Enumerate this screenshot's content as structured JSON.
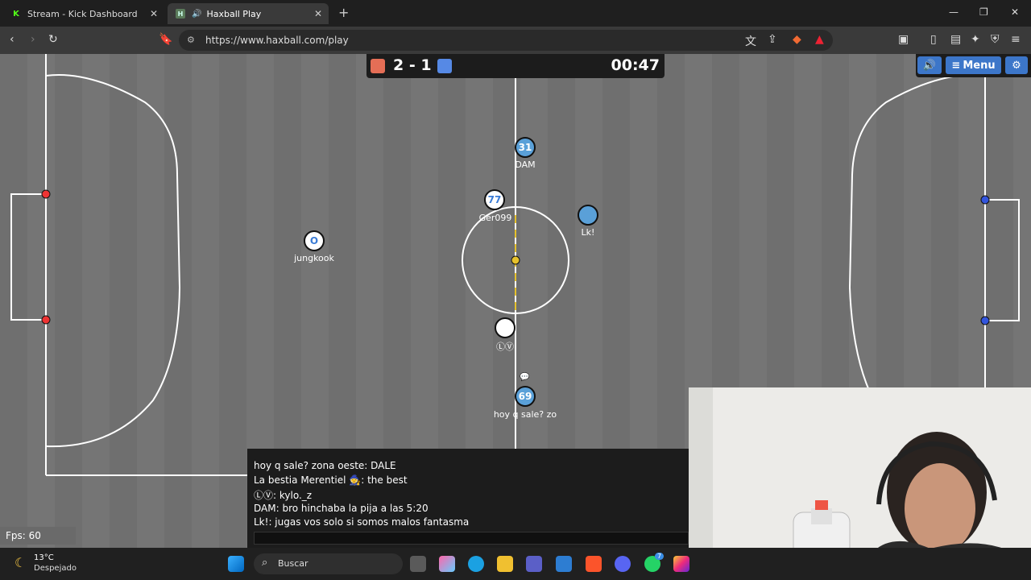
{
  "browser": {
    "tabs": [
      {
        "title": "Stream - Kick Dashboard",
        "favicon": "K"
      },
      {
        "title": "Haxball Play",
        "favicon": "H",
        "active": true,
        "audio": true
      }
    ],
    "new_tab": "+",
    "url": "https://www.haxball.com/play",
    "window": {
      "minimize": "—",
      "maximize": "❐",
      "close": "✕"
    }
  },
  "scoreboard": {
    "red_color": "#e56e56",
    "blue_color": "#5689e5",
    "score": "2 - 1",
    "timer": "00:47"
  },
  "topbar": {
    "sound_icon": "speaker-icon",
    "menu_label": "Menu",
    "settings_icon": "gear-icon"
  },
  "players": [
    {
      "label": "31",
      "name": "DAM",
      "team": "blue"
    },
    {
      "label": "77",
      "name": "Ger099",
      "team": "white"
    },
    {
      "label": "",
      "name": "Lk!",
      "team": "blue"
    },
    {
      "label": "O",
      "name": "jungkook",
      "team": "white"
    },
    {
      "label": "",
      "name": "ⓁⓋ",
      "team": "white"
    },
    {
      "label": "69",
      "name": "hoy q sale? zo",
      "team": "blue"
    }
  ],
  "chat": {
    "messages": [
      "hoy q sale? zona oeste: DALE",
      "La bestia Merentiel 🧙: the best",
      "ⓁⓋ: kylo._z",
      "DAM: bro hinchaba la pija a las 5:20",
      "Lk!: jugas vos solo si somos malos fantasma"
    ],
    "input_value": ""
  },
  "fps": "Fps: 60",
  "taskbar": {
    "weather_temp": "13°C",
    "weather_desc": "Despejado",
    "search_placeholder": "Buscar",
    "notification_badge": "7"
  }
}
